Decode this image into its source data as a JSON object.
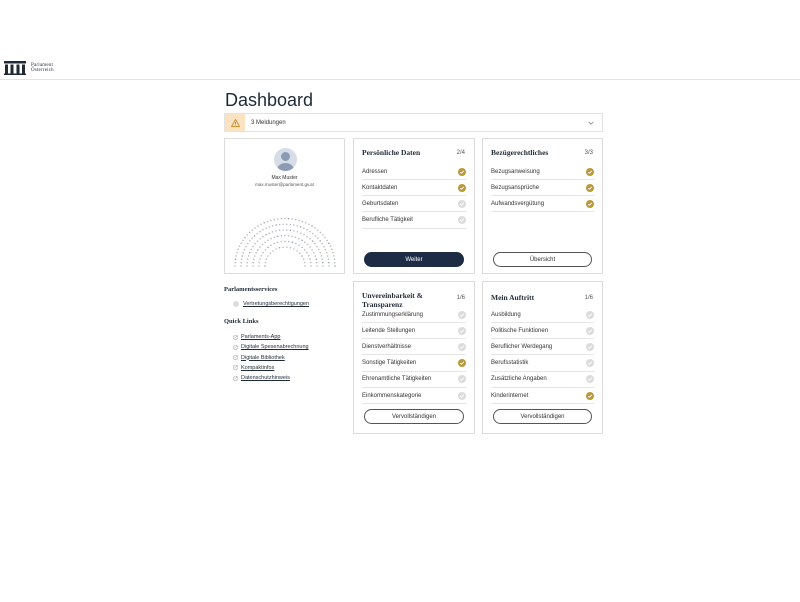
{
  "header": {
    "logo_line1": "Parlament",
    "logo_line2": "Österreich"
  },
  "page": {
    "title": "Dashboard"
  },
  "alert": {
    "text": "3 Meldungen"
  },
  "profile": {
    "name": "Max Muster",
    "email": "max.muster@parlament.gv.at"
  },
  "colors": {
    "navy": "#1d2b45",
    "gold": "#b99a3a",
    "alert_bg": "#fbe3c1",
    "pending": "#dcdcdc"
  },
  "cards": {
    "personal": {
      "title": "Persönliche Daten",
      "count": "2/4",
      "button": "Weiter",
      "items": [
        {
          "label": "Adressen",
          "done": true
        },
        {
          "label": "Kontaktdaten",
          "done": true
        },
        {
          "label": "Geburtsdaten",
          "done": false
        },
        {
          "label": "Berufliche Tätigkeit",
          "done": false
        }
      ]
    },
    "bezuege": {
      "title": "Bezügerechtliches",
      "count": "3/3",
      "button": "Übersicht",
      "items": [
        {
          "label": "Bezugsanweisung",
          "done": true
        },
        {
          "label": "Bezugsansprüche",
          "done": true
        },
        {
          "label": "Aufwandsvergütung",
          "done": true
        }
      ]
    },
    "unvereinbarkeit": {
      "title_line1": "Unvereinbarkeit &",
      "title_line2": "Transparenz",
      "count": "1/6",
      "button": "Vervollständigen",
      "items": [
        {
          "label": "Zustimmungserklärung",
          "done": false
        },
        {
          "label": "Leitende Stellungen",
          "done": false
        },
        {
          "label": "Dienstverhältnisse",
          "done": false
        },
        {
          "label": "Sonstige Tätigkeiten",
          "done": true
        },
        {
          "label": "Ehrenamtliche Tätigkeiten",
          "done": false
        },
        {
          "label": "Einkommenskategorie",
          "done": false
        }
      ]
    },
    "auftritt": {
      "title": "Mein Auftritt",
      "count": "1/6",
      "button": "Vervollständigen",
      "items": [
        {
          "label": "Ausbildung",
          "done": false
        },
        {
          "label": "Politische Funktionen",
          "done": false
        },
        {
          "label": "Beruflicher Werdegang",
          "done": false
        },
        {
          "label": "Berufsstatistik",
          "done": false
        },
        {
          "label": "Zusätzliche Angaben",
          "done": false
        },
        {
          "label": "Kinderinternet",
          "done": true
        }
      ]
    }
  },
  "services": {
    "title": "Parlamentsservices",
    "link": "Vertretungsberechtigungen"
  },
  "quick_links": {
    "title": "Quick Links",
    "items": [
      "Parlaments-App",
      "Digitale Spesenabrechnung",
      "Digitale Bibliothek",
      "Kompaktinfos",
      "Datenschutzhinweis"
    ]
  }
}
